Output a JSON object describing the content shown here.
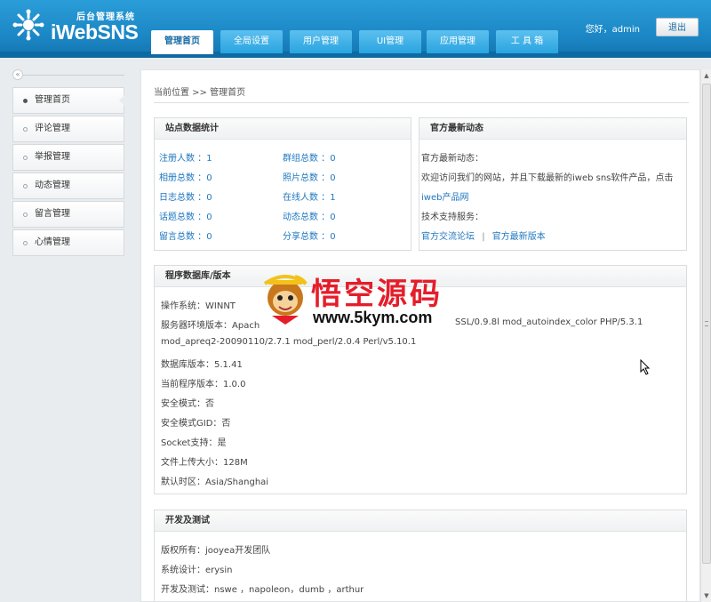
{
  "header": {
    "brand": "iWebSNS",
    "brand_sub": "后台管理系统",
    "greeting": "您好，admin",
    "logout_label": "退出",
    "tabs": [
      {
        "label": "管理首页"
      },
      {
        "label": "全局设置"
      },
      {
        "label": "用户管理"
      },
      {
        "label": "UI管理"
      },
      {
        "label": "应用管理"
      },
      {
        "label": "工 具 箱"
      }
    ]
  },
  "sidebar": {
    "collapse_label": "«",
    "items": [
      {
        "label": "管理首页"
      },
      {
        "label": "评论管理"
      },
      {
        "label": "举报管理"
      },
      {
        "label": "动态管理"
      },
      {
        "label": "留言管理"
      },
      {
        "label": "心情管理"
      }
    ]
  },
  "breadcrumb": "当前位置 >> 管理首页",
  "stats_panel": {
    "title": "站点数据统计",
    "rows": [
      {
        "label": "注册人数 ：",
        "value": "1",
        "label2": "群组总数 ：",
        "value2": "0"
      },
      {
        "label": "相册总数 ：",
        "value": "0",
        "label2": "照片总数 ：",
        "value2": "0"
      },
      {
        "label": "日志总数 ：",
        "value": "0",
        "label2": "在线人数 ：",
        "value2": "1"
      },
      {
        "label": "话题总数 ：",
        "value": "0",
        "label2": "动态总数 ：",
        "value2": "0"
      },
      {
        "label": "留言总数 ：",
        "value": "0",
        "label2": "分享总数 ：",
        "value2": "0"
      }
    ]
  },
  "news_panel": {
    "title": "官方最新动态",
    "line1": "官方最新动态：",
    "line2": "欢迎访问我们的网站，并且下载最新的iweb sns软件产品，点击",
    "link_product": "iweb产品网",
    "line4": "技术支持服务：",
    "link_forum": "官方交流论坛",
    "separator": "|",
    "link_version": "官方最新版本"
  },
  "program_panel": {
    "title": "程序数据库/版本",
    "lines": [
      "操作系统：WINNT",
      "服务器环境版本：Apach",
      "mod_apreq2-20090110/2.7.1 mod_perl/2.0.4 Perl/v5.10.1",
      "数据库版本：5.1.41",
      "当前程序版本：1.0.0",
      "安全模式：否",
      "安全模式GID：否",
      "Socket支持：是",
      "文件上传大小：128M",
      "默认时区：Asia/Shanghai"
    ],
    "server_tail": "SSL/0.9.8l mod_autoindex_color PHP/5.3.1"
  },
  "dev_panel": {
    "title": "开发及测试",
    "lines": [
      "版权所有：jooyea开发团队",
      "系统设计：erysin",
      "开发及测试：nswe ，napoleon，dumb ，arthur"
    ]
  },
  "watermark": {
    "cn_text": "悟空源码",
    "url": "www.5kym.com"
  },
  "colors": {
    "header_blue": "#1b86c4",
    "link_blue": "#2078c0",
    "watermark_red": "#e51d2a"
  }
}
